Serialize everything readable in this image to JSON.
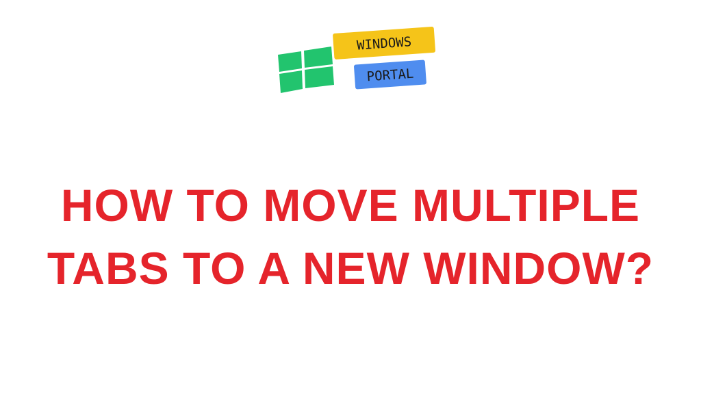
{
  "logo": {
    "line1": "WINDOWS",
    "line2": "PORTAL",
    "icon": "windows-logo-icon",
    "colors": {
      "windows_tiles": "#22c46e",
      "windows_badge": "#f5c419",
      "portal_badge": "#4f8def"
    }
  },
  "headline": {
    "line1": "HOW TO MOVE MULTIPLE",
    "line2": "TABS TO A NEW WINDOW?",
    "color": "#e5242b"
  }
}
